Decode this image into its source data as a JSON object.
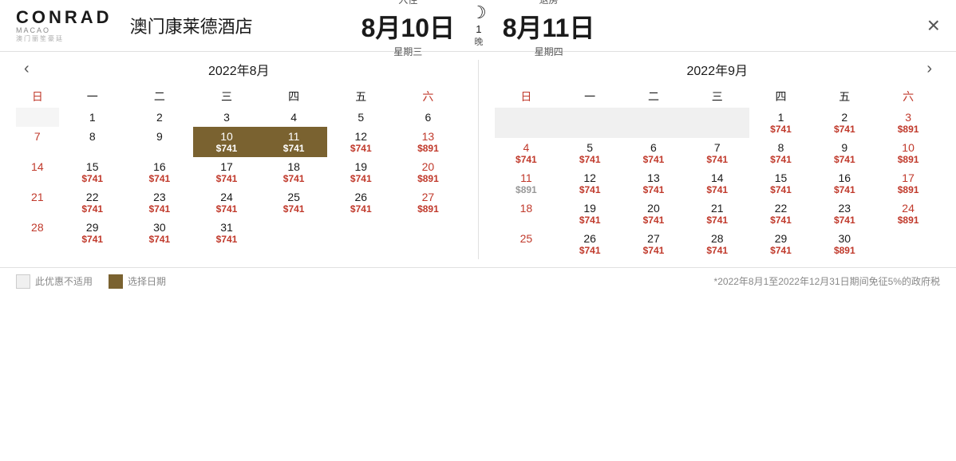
{
  "header": {
    "logo_brand": "CONRAD",
    "logo_sub": "MACAO\n澳门丽笙豪廷",
    "hotel_name": "澳门康莱德酒店",
    "checkin_label": "入住",
    "checkin_date": "8月10日",
    "checkin_weekday": "星期三",
    "checkout_label": "退房",
    "checkout_date": "8月11日",
    "checkout_weekday": "星期四",
    "nights_count": "1",
    "nights_label": "晚",
    "close_label": "×"
  },
  "august": {
    "title": "2022年8月",
    "days_header": [
      "日",
      "一",
      "二",
      "三",
      "四",
      "五",
      "六"
    ],
    "weeks": [
      [
        {
          "num": "",
          "price": "",
          "type": "empty"
        },
        {
          "num": "1",
          "price": "",
          "type": ""
        },
        {
          "num": "2",
          "price": "",
          "type": ""
        },
        {
          "num": "3",
          "price": "",
          "type": ""
        },
        {
          "num": "4",
          "price": "",
          "type": ""
        },
        {
          "num": "5",
          "price": "",
          "type": ""
        },
        {
          "num": "6",
          "price": "",
          "type": ""
        }
      ],
      [
        {
          "num": "7",
          "price": "",
          "type": "sunday"
        },
        {
          "num": "8",
          "price": "",
          "type": ""
        },
        {
          "num": "9",
          "price": "",
          "type": ""
        },
        {
          "num": "10",
          "price": "$741",
          "type": "selected sunday"
        },
        {
          "num": "11",
          "price": "$741",
          "type": "selected"
        },
        {
          "num": "12",
          "price": "$741",
          "type": ""
        },
        {
          "num": "13",
          "price": "$891",
          "type": "saturday"
        }
      ],
      [
        {
          "num": "14",
          "price": "",
          "type": "sunday"
        },
        {
          "num": "15",
          "price": "$741",
          "type": ""
        },
        {
          "num": "16",
          "price": "$741",
          "type": ""
        },
        {
          "num": "17",
          "price": "$741",
          "type": ""
        },
        {
          "num": "18",
          "price": "$741",
          "type": ""
        },
        {
          "num": "19",
          "price": "$741",
          "type": ""
        },
        {
          "num": "20",
          "price": "$891",
          "type": "saturday"
        }
      ],
      [
        {
          "num": "21",
          "price": "",
          "type": "sunday"
        },
        {
          "num": "22",
          "price": "$741",
          "type": ""
        },
        {
          "num": "23",
          "price": "$741",
          "type": ""
        },
        {
          "num": "24",
          "price": "$741",
          "type": ""
        },
        {
          "num": "25",
          "price": "$741",
          "type": ""
        },
        {
          "num": "26",
          "price": "$741",
          "type": ""
        },
        {
          "num": "27",
          "price": "$891",
          "type": "saturday"
        }
      ],
      [
        {
          "num": "28",
          "price": "",
          "type": "sunday"
        },
        {
          "num": "29",
          "price": "$741",
          "type": ""
        },
        {
          "num": "30",
          "price": "$741",
          "type": ""
        },
        {
          "num": "31",
          "price": "$741",
          "type": ""
        },
        {
          "num": "",
          "price": "",
          "type": "empty"
        },
        {
          "num": "",
          "price": "",
          "type": "empty"
        },
        {
          "num": "",
          "price": "",
          "type": "empty"
        }
      ]
    ]
  },
  "september": {
    "title": "2022年9月",
    "days_header": [
      "日",
      "一",
      "二",
      "三",
      "四",
      "五",
      "六"
    ],
    "weeks": [
      [
        {
          "num": "",
          "price": "",
          "type": "empty"
        },
        {
          "num": "",
          "price": "",
          "type": "empty"
        },
        {
          "num": "",
          "price": "",
          "type": "empty"
        },
        {
          "num": "",
          "price": "",
          "type": "empty"
        },
        {
          "num": "1",
          "price": "$741",
          "type": ""
        },
        {
          "num": "2",
          "price": "$741",
          "type": ""
        },
        {
          "num": "3",
          "price": "$891",
          "type": "saturday"
        }
      ],
      [
        {
          "num": "4",
          "price": "$741",
          "type": "sunday"
        },
        {
          "num": "5",
          "price": "$741",
          "type": ""
        },
        {
          "num": "6",
          "price": "$741",
          "type": ""
        },
        {
          "num": "7",
          "price": "$741",
          "type": ""
        },
        {
          "num": "8",
          "price": "$741",
          "type": ""
        },
        {
          "num": "9",
          "price": "$741",
          "type": ""
        },
        {
          "num": "10",
          "price": "$891",
          "type": "saturday"
        }
      ],
      [
        {
          "num": "11",
          "price": "$891",
          "type": "sunday grey"
        },
        {
          "num": "12",
          "price": "$741",
          "type": ""
        },
        {
          "num": "13",
          "price": "$741",
          "type": ""
        },
        {
          "num": "14",
          "price": "$741",
          "type": ""
        },
        {
          "num": "15",
          "price": "$741",
          "type": ""
        },
        {
          "num": "16",
          "price": "$741",
          "type": ""
        },
        {
          "num": "17",
          "price": "$891",
          "type": "saturday"
        }
      ],
      [
        {
          "num": "18",
          "price": "",
          "type": "sunday"
        },
        {
          "num": "19",
          "price": "$741",
          "type": ""
        },
        {
          "num": "20",
          "price": "$741",
          "type": ""
        },
        {
          "num": "21",
          "price": "$741",
          "type": ""
        },
        {
          "num": "22",
          "price": "$741",
          "type": ""
        },
        {
          "num": "23",
          "price": "$741",
          "type": ""
        },
        {
          "num": "24",
          "price": "$891",
          "type": "saturday"
        }
      ],
      [
        {
          "num": "25",
          "price": "",
          "type": "sunday"
        },
        {
          "num": "26",
          "price": "$741",
          "type": ""
        },
        {
          "num": "27",
          "price": "$741",
          "type": ""
        },
        {
          "num": "28",
          "price": "$741",
          "type": ""
        },
        {
          "num": "29",
          "price": "$741",
          "type": ""
        },
        {
          "num": "30",
          "price": "$891",
          "type": ""
        },
        {
          "num": "",
          "price": "",
          "type": "empty"
        }
      ]
    ]
  },
  "footer": {
    "legend_unavailable": "此优惠不适用",
    "legend_selected": "选择日期",
    "footnote": "*2022年8月1至2022年12月31日期间免征5%的政府税"
  }
}
